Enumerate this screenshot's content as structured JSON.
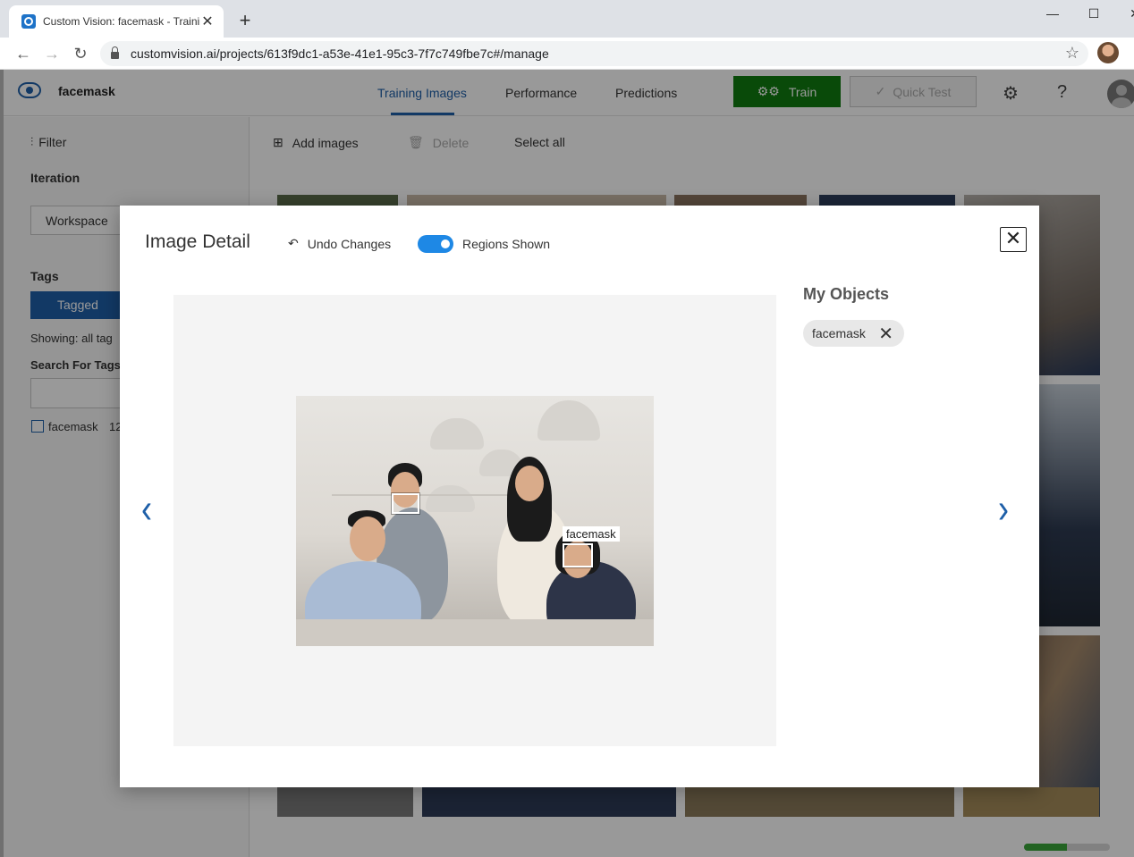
{
  "browser": {
    "tab_title": "Custom Vision: facemask - Trainin",
    "url": "customvision.ai/projects/613f9dc1-a53e-41e1-95c3-7f7c749fbe7c#/manage"
  },
  "header": {
    "project_name": "facemask",
    "tabs": [
      "Training Images",
      "Performance",
      "Predictions"
    ],
    "active_tab": "Training Images",
    "train_label": "Train",
    "quick_test_label": "Quick Test",
    "help_glyph": "?"
  },
  "sidebar": {
    "filter_label": "Filter",
    "iteration_heading": "Iteration",
    "workspace_label": "Workspace",
    "tags_heading": "Tags",
    "tagged_label": "Tagged",
    "showing_text": "Showing: all tag",
    "search_heading": "Search For Tags",
    "tag_name": "facemask",
    "tag_count": "12"
  },
  "main_toolbar": {
    "add_images": "Add images",
    "delete": "Delete",
    "select_all": "Select all"
  },
  "modal": {
    "title": "Image Detail",
    "undo_label": "Undo Changes",
    "regions_label": "Regions Shown",
    "regions_shown": true,
    "objects_title": "My Objects",
    "object_chip": "facemask",
    "region_label": "facemask"
  },
  "upload_progress": 0.5,
  "colors": {
    "accent": "#1e5fa8",
    "train": "#107c10",
    "toggle": "#1e88e5"
  },
  "icons": [
    "eye-logo-icon",
    "gear-icon",
    "help-icon",
    "filter-icon",
    "add-image-icon",
    "trash-icon",
    "undo-icon",
    "close-icon",
    "chevron-left-icon",
    "chevron-right-icon"
  ]
}
